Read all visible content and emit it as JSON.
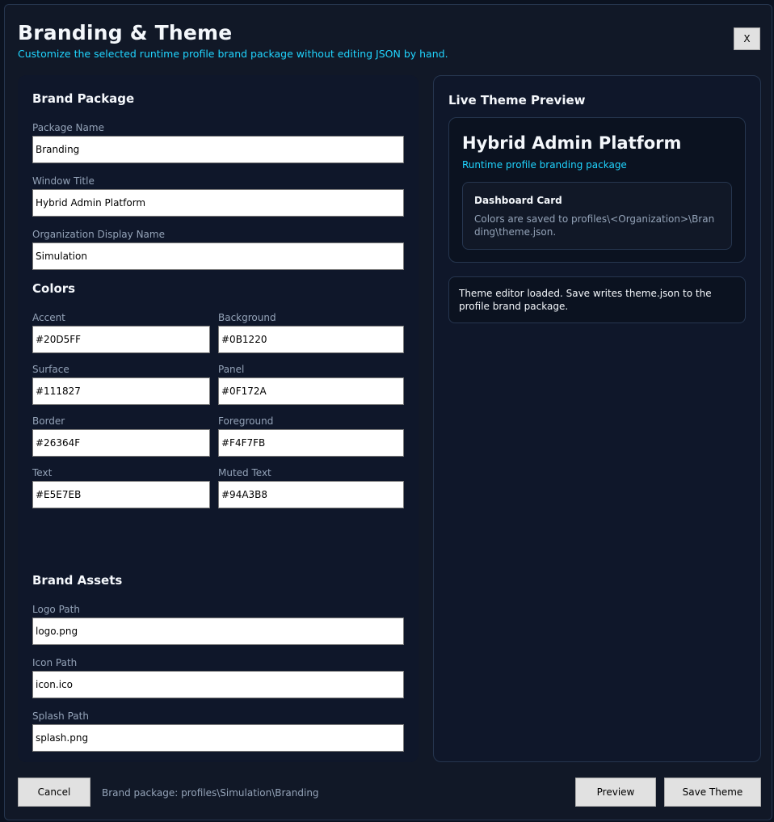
{
  "header": {
    "title": "Branding & Theme",
    "subtitle": "Customize the selected runtime profile brand package without editing JSON by hand.",
    "close_label": "X"
  },
  "brand_package": {
    "section_title": "Brand Package",
    "package_name": {
      "label": "Package Name",
      "value": "Branding"
    },
    "window_title": {
      "label": "Window Title",
      "value": "Hybrid Admin Platform"
    },
    "org_display_name": {
      "label": "Organization Display Name",
      "value": "Simulation"
    }
  },
  "colors": {
    "section_title": "Colors",
    "accent": {
      "label": "Accent",
      "value": "#20D5FF"
    },
    "background": {
      "label": "Background",
      "value": "#0B1220"
    },
    "surface": {
      "label": "Surface",
      "value": "#111827"
    },
    "panel": {
      "label": "Panel",
      "value": "#0F172A"
    },
    "border": {
      "label": "Border",
      "value": "#26364F"
    },
    "foreground": {
      "label": "Foreground",
      "value": "#F4F7FB"
    },
    "text": {
      "label": "Text",
      "value": "#E5E7EB"
    },
    "muted_text": {
      "label": "Muted Text",
      "value": "#94A3B8"
    }
  },
  "brand_assets": {
    "section_title": "Brand Assets",
    "logo_path": {
      "label": "Logo Path",
      "value": "logo.png"
    },
    "icon_path": {
      "label": "Icon Path",
      "value": "icon.ico"
    },
    "splash_path": {
      "label": "Splash Path",
      "value": "splash.png"
    }
  },
  "preview": {
    "section_title": "Live Theme Preview",
    "app_title": "Hybrid Admin Platform",
    "app_subtitle": "Runtime profile branding package",
    "card_title": "Dashboard Card",
    "card_body": "Colors are saved to profiles\\<Organization>\\Branding\\theme.json.",
    "status": "Theme editor loaded. Save writes theme.json to the profile brand package."
  },
  "footer": {
    "cancel_label": "Cancel",
    "package_path": "Brand package: profiles\\Simulation\\Branding",
    "preview_label": "Preview",
    "save_label": "Save Theme"
  }
}
